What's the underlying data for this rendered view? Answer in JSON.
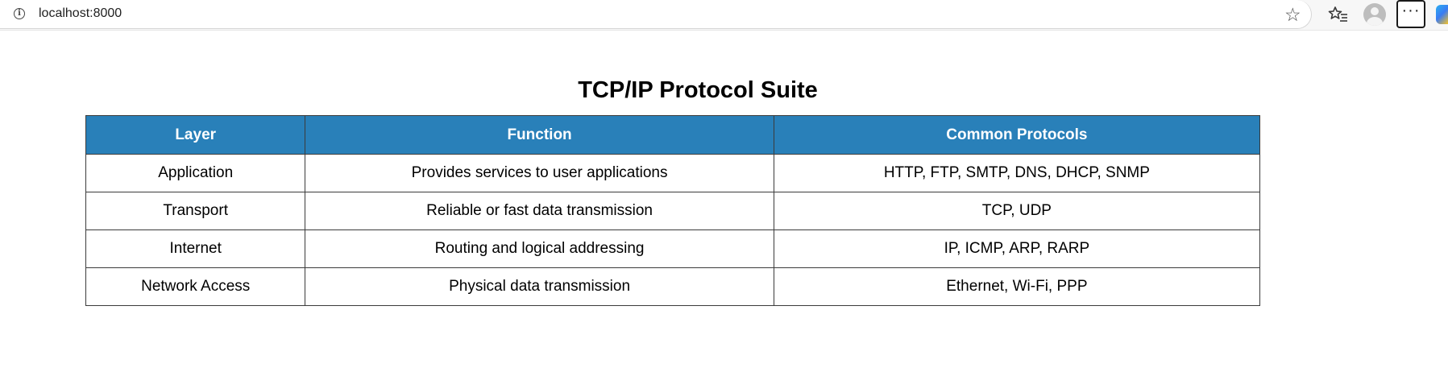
{
  "browser": {
    "url": "localhost:8000",
    "icons": {
      "info": "info-icon",
      "star": "star-icon",
      "favorites": "favorites-icon",
      "profile": "profile-icon",
      "more": "more-icon",
      "copilot": "copilot-icon"
    }
  },
  "page": {
    "title": "TCP/IP Protocol Suite"
  },
  "table": {
    "headers": [
      "Layer",
      "Function",
      "Common Protocols"
    ],
    "rows": [
      [
        "Application",
        "Provides services to user applications",
        "HTTP, FTP, SMTP, DNS, DHCP, SNMP"
      ],
      [
        "Transport",
        "Reliable or fast data transmission",
        "TCP, UDP"
      ],
      [
        "Internet",
        "Routing and logical addressing",
        "IP, ICMP, ARP, RARP"
      ],
      [
        "Network Access",
        "Physical data transmission",
        "Ethernet, Wi-Fi, PPP"
      ]
    ],
    "header_color": "#2980b9"
  }
}
